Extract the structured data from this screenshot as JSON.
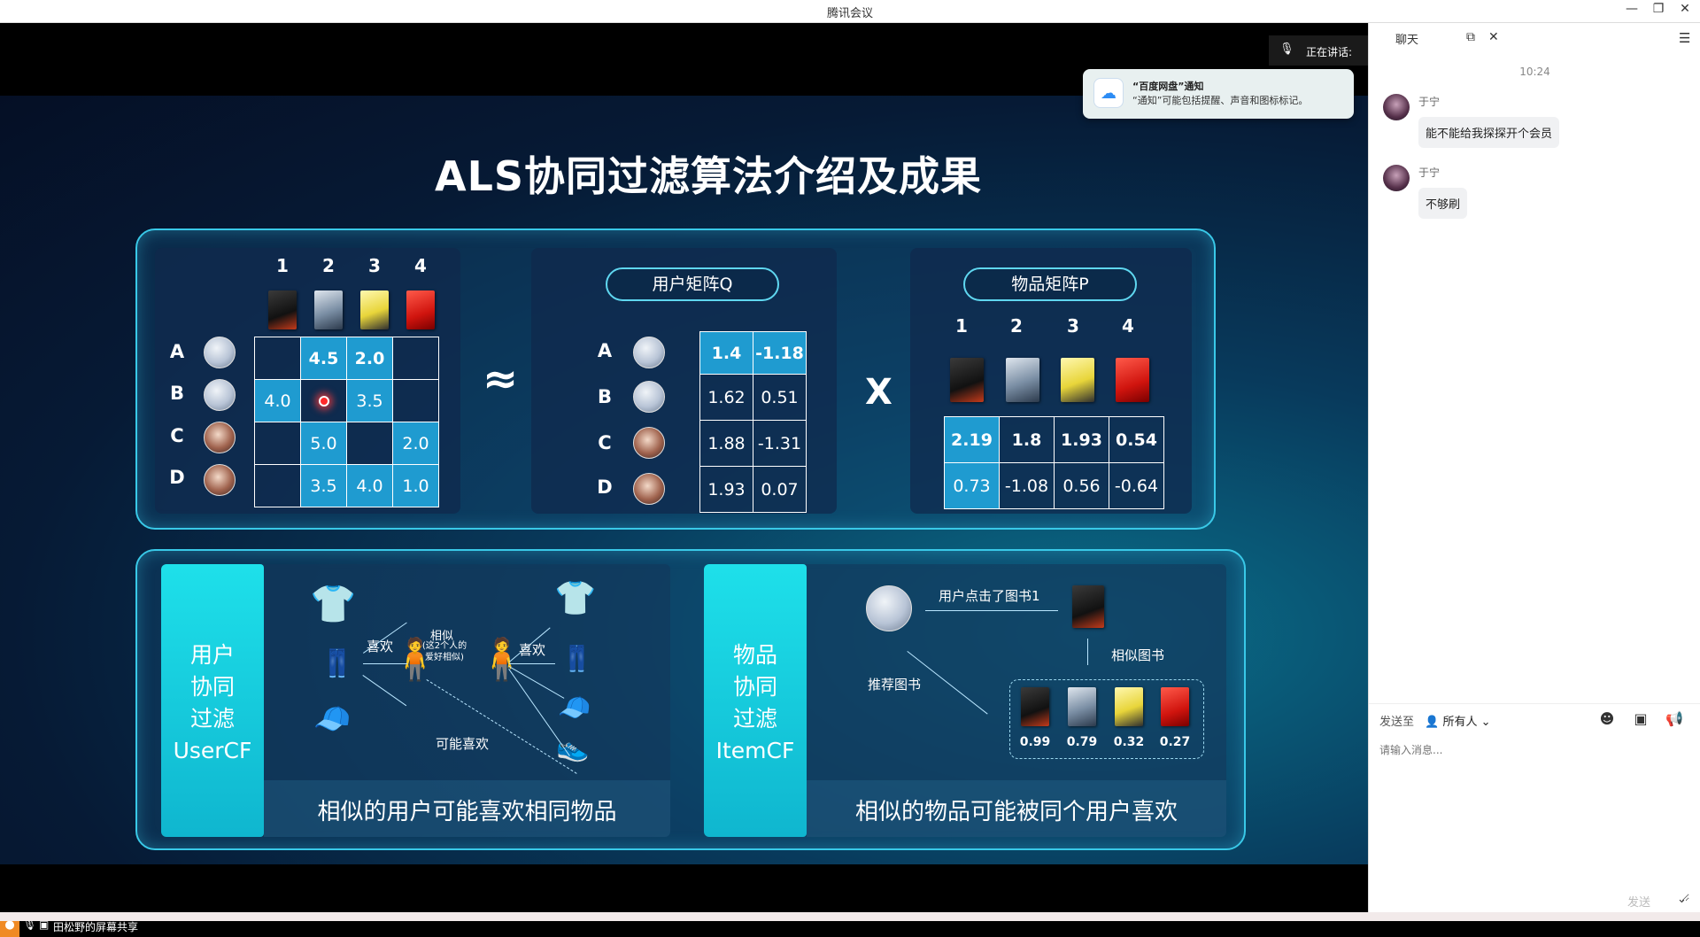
{
  "window": {
    "title": "腾讯会议",
    "minimize": "—",
    "restore": "❐",
    "close": "✕"
  },
  "slide": {
    "title": "ALS协同过滤算法介绍及成果",
    "rating_matrix": {
      "col_labels": [
        "1",
        "2",
        "3",
        "4"
      ],
      "row_labels": [
        "A",
        "B",
        "C",
        "D"
      ],
      "cells": [
        [
          "",
          "4.5",
          "2.0",
          ""
        ],
        [
          "4.0",
          "",
          "3.5",
          ""
        ],
        [
          "",
          "5.0",
          "",
          "2.0"
        ],
        [
          "",
          "3.5",
          "4.0",
          "1.0"
        ]
      ]
    },
    "approx_symbol": "≈",
    "times_symbol": "X",
    "user_matrix": {
      "title": "用户矩阵Q",
      "row_labels": [
        "A",
        "B",
        "C",
        "D"
      ],
      "cells": [
        [
          "1.4",
          "-1.18"
        ],
        [
          "1.62",
          "0.51"
        ],
        [
          "1.88",
          "-1.31"
        ],
        [
          "1.93",
          "0.07"
        ]
      ]
    },
    "item_matrix": {
      "title": "物品矩阵P",
      "col_labels": [
        "1",
        "2",
        "3",
        "4"
      ],
      "cells": [
        [
          "2.19",
          "1.8",
          "1.93",
          "0.54"
        ],
        [
          "0.73",
          "-1.08",
          "0.56",
          "-0.64"
        ]
      ]
    },
    "usercf": {
      "card": [
        "用户",
        "协同",
        "过滤",
        "UserCF"
      ],
      "likes_left": "喜欢",
      "similar": "相似",
      "similar_note": "(这2个人的\n爱好相似)",
      "likes_right": "喜欢",
      "maybe_likes": "可能喜欢",
      "caption": "相似的用户可能喜欢相同物品"
    },
    "itemcf": {
      "card": [
        "物品",
        "协同",
        "过滤",
        "ItemCF"
      ],
      "clicked": "用户点击了图书1",
      "similar_books": "相似图书",
      "recommend": "推荐图书",
      "scores": [
        "0.99",
        "0.79",
        "0.32",
        "0.27"
      ],
      "caption": "相似的物品可能被同个用户喜欢"
    }
  },
  "speaking": {
    "label": "正在讲话:"
  },
  "notification": {
    "title": "“百度网盘”通知",
    "body": "“通知”可能包括提醒、声音和图标标记。"
  },
  "share_bar": {
    "label": "田松野的屏幕共享"
  },
  "chat": {
    "header_tab": "聊天",
    "time": "10:24",
    "messages": [
      {
        "name": "于宁",
        "text": "能不能给我探探开个会员"
      },
      {
        "name": "于宁",
        "text": "不够刷"
      }
    ],
    "send_to_label": "发送至",
    "send_to_value": "所有人",
    "input_placeholder": "请输入消息...",
    "send_button": "发送"
  }
}
